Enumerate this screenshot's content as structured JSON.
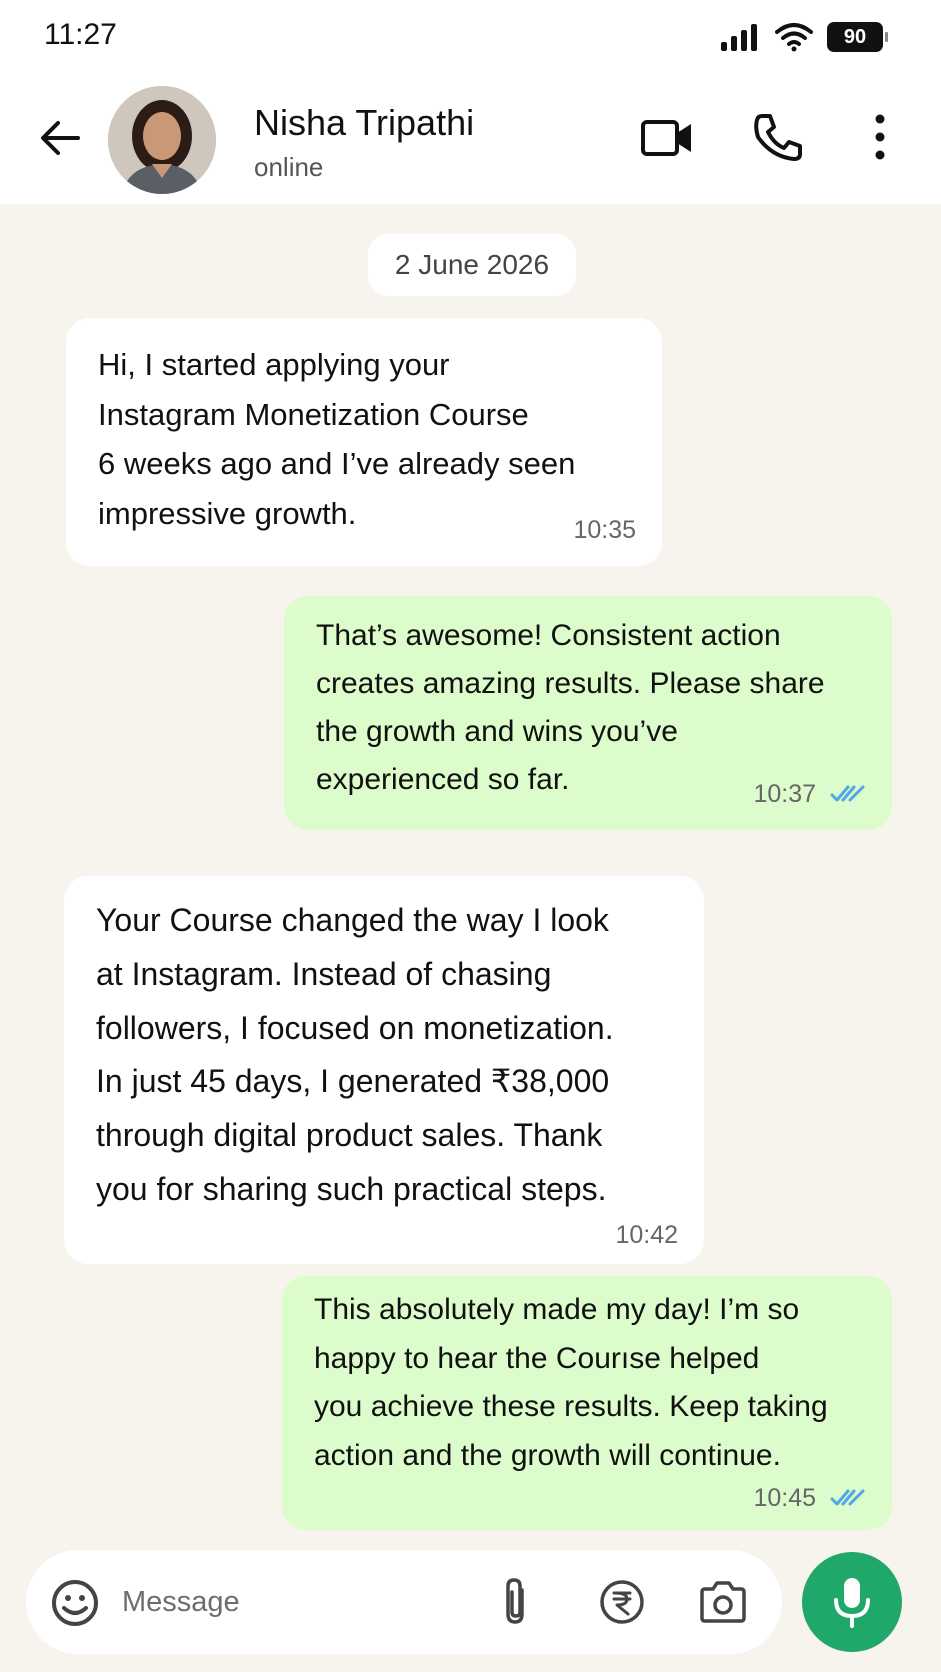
{
  "status_bar": {
    "time": "11:27",
    "battery": "90",
    "icons": [
      "signal-icon",
      "wifi-icon",
      "battery-icon"
    ]
  },
  "header": {
    "contact_name": "Nisha Tripathi",
    "contact_status": "online",
    "icons": [
      "back-arrow-icon",
      "video-camera-icon",
      "phone-icon",
      "more-vertical-icon"
    ]
  },
  "chat": {
    "date_label": "2 June 2026",
    "messages": [
      {
        "direction": "incoming",
        "lines": [
          "Hi, I started applying your",
          "Instagram Monetization Course",
          "6 weeks ago and I’ve already seen",
          "impressive growth."
        ],
        "time": "10:35"
      },
      {
        "direction": "outgoing",
        "lines": [
          "That’s awesome! Consistent action",
          "creates amazing results. Please share",
          "the growth and wins you’ve",
          "experienced so far."
        ],
        "time": "10:37",
        "read": true
      },
      {
        "direction": "incoming",
        "lines": [
          "Your Course changed the way I look",
          "at Instagram. Instead of chasing",
          "followers, I focused on monetization.",
          "In just 45 days, I generated ₹38,000",
          "through digital product sales. Thank",
          "you for sharing such practical steps."
        ],
        "time": "10:42"
      },
      {
        "direction": "outgoing",
        "lines": [
          "This absolutely made my day! I’m so",
          "happy to hear the Courıse helped",
          "you achieve these results. Keep taking",
          "action and the growth will continue."
        ],
        "time": "10:45",
        "read": true
      }
    ]
  },
  "composer": {
    "placeholder": "Message",
    "value": "",
    "icons": [
      "emoji-icon",
      "paperclip-icon",
      "rupee-icon",
      "camera-icon",
      "microphone-icon"
    ]
  },
  "colors": {
    "outgoing_bubble": "#dcfccb",
    "incoming_bubble": "#ffffff",
    "chat_background": "#f7f4ee",
    "accent": "#1fa86a",
    "read_ticks": "#4fa6e8"
  }
}
